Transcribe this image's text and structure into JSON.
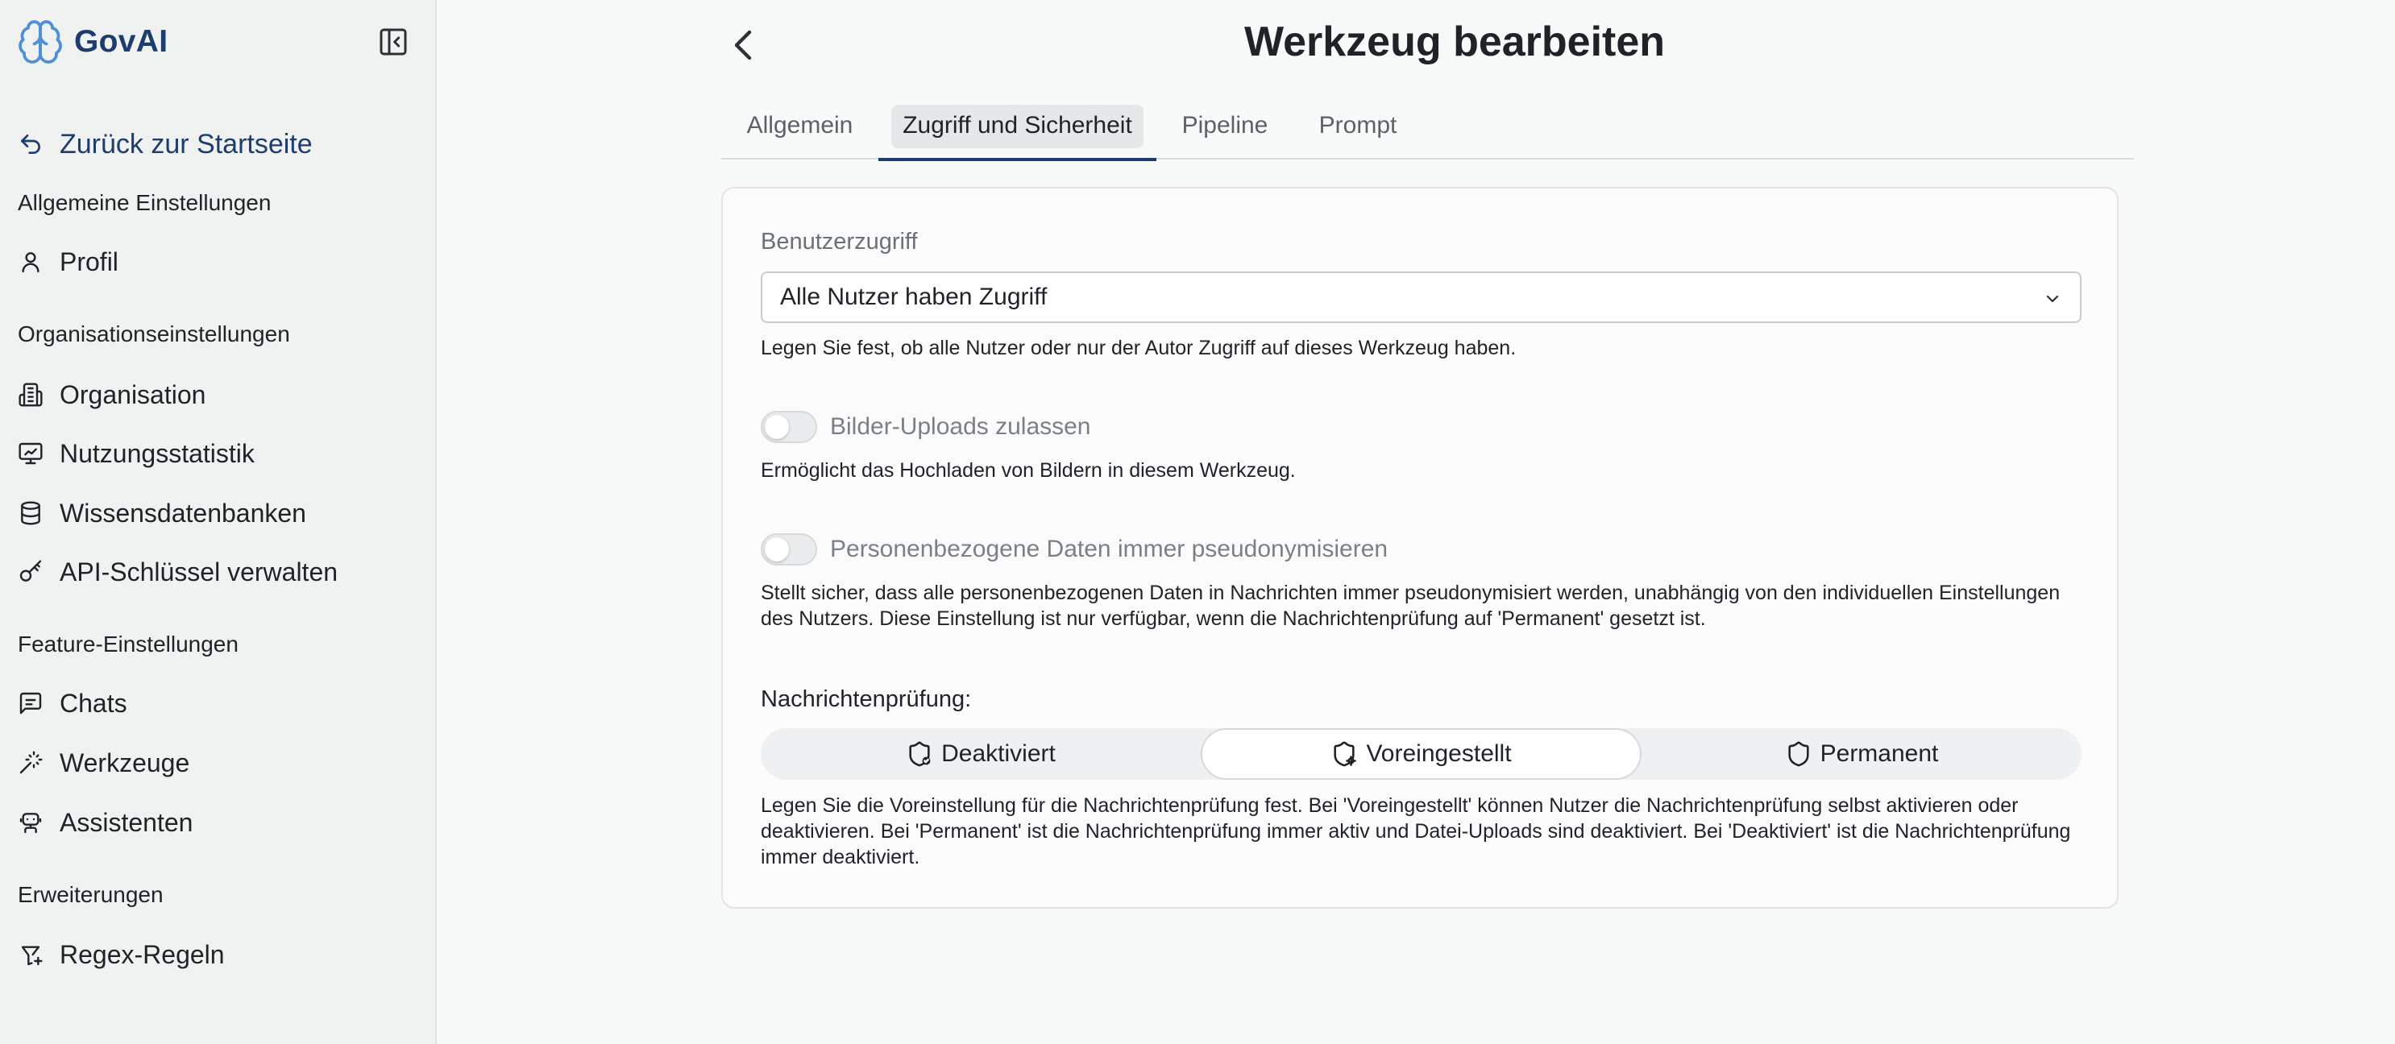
{
  "brand": {
    "name": "GovAI",
    "icon": "brain-logo-icon",
    "color": "#1c3d6e"
  },
  "sidebar": {
    "back_label": "Zurück zur Startseite",
    "sections": {
      "general": "Allgemeine Einstellungen",
      "organization": "Organisationseinstellungen",
      "features": "Feature-Einstellungen",
      "extensions": "Erweiterungen"
    },
    "items": {
      "profile": "Profil",
      "organization": "Organisation",
      "usage": "Nutzungsstatistik",
      "knowledge": "Wissensdatenbanken",
      "api_keys": "API-Schlüssel verwalten",
      "chats": "Chats",
      "tools": "Werkzeuge",
      "assistants": "Assistenten",
      "regex": "Regex-Regeln"
    }
  },
  "header": {
    "title": "Werkzeug bearbeiten"
  },
  "tabs": [
    {
      "label": "Allgemein",
      "active": false
    },
    {
      "label": "Zugriff und Sicherheit",
      "active": true
    },
    {
      "label": "Pipeline",
      "active": false
    },
    {
      "label": "Prompt",
      "active": false
    }
  ],
  "form": {
    "access": {
      "label": "Benutzerzugriff",
      "selected": "Alle Nutzer haben Zugriff",
      "help": "Legen Sie fest, ob alle Nutzer oder nur der Autor Zugriff auf dieses Werkzeug haben."
    },
    "image_uploads": {
      "label": "Bilder-Uploads zulassen",
      "enabled": false,
      "help": "Ermöglicht das Hochladen von Bildern in diesem Werkzeug."
    },
    "pseudonymize": {
      "label": "Personenbezogene Daten immer pseudonymisieren",
      "enabled": false,
      "help": "Stellt sicher, dass alle personenbezogenen Daten in Nachrichten immer pseudonymisiert werden, unabhängig von den individuellen Einstellungen des Nutzers. Diese Einstellung ist nur verfügbar, wenn die Nachrichtenprüfung auf 'Permanent' gesetzt ist."
    },
    "message_check": {
      "label": "Nachrichtenprüfung:",
      "options": [
        "Deaktiviert",
        "Voreingestellt",
        "Permanent"
      ],
      "selected": "Voreingestellt",
      "help": "Legen Sie die Voreinstellung für die Nachrichtenprüfung fest. Bei 'Voreingestellt' können Nutzer die Nachrichtenprüfung selbst aktivieren oder deaktivieren. Bei 'Permanent' ist die Nachrichtenprüfung immer aktiv und Datei-Uploads sind deaktiviert. Bei 'Deaktiviert' ist die Nachrichtenprüfung immer deaktiviert."
    }
  }
}
